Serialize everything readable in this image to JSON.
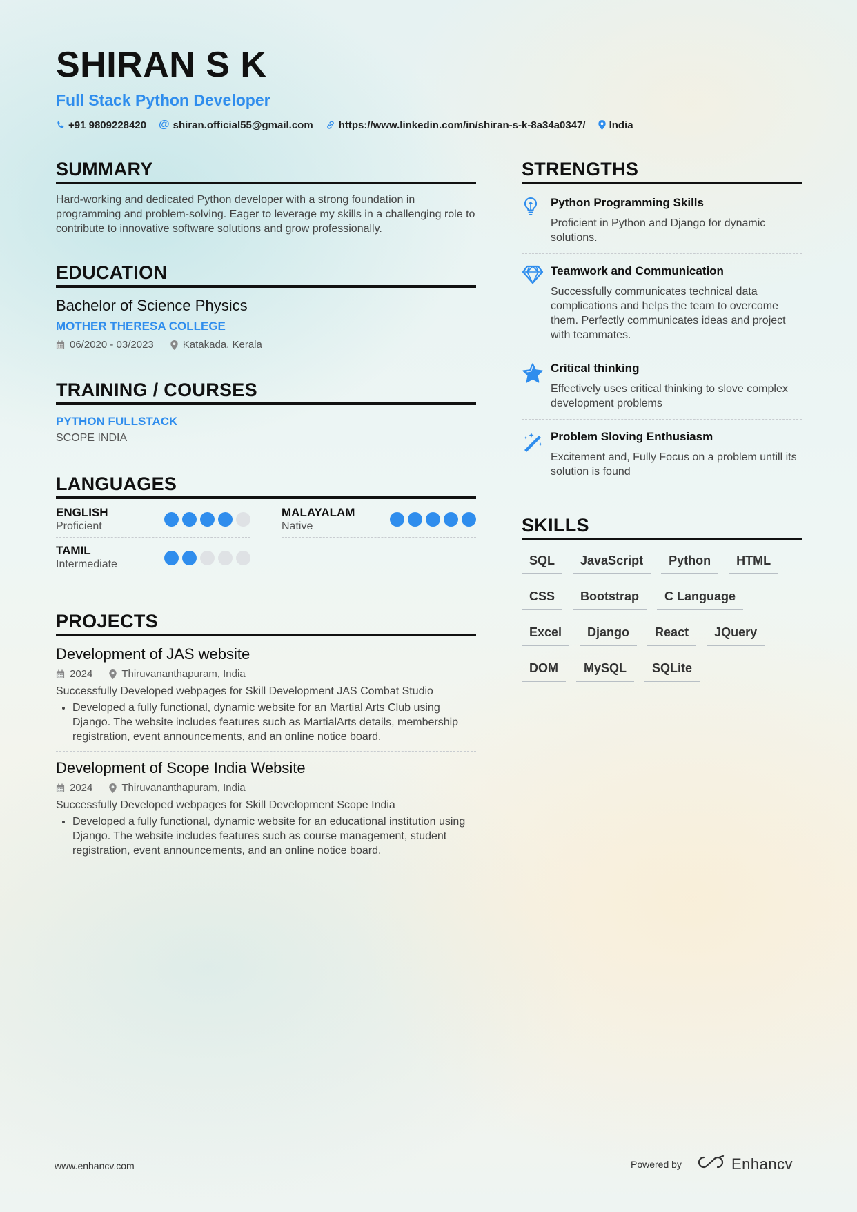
{
  "header": {
    "name": "SHIRAN S K",
    "title": "Full Stack Python Developer",
    "phone": "+91 9809228420",
    "email": "shiran.official55@gmail.com",
    "linkedin": "https://www.linkedin.com/in/shiran-s-k-8a34a0347/",
    "location": "India"
  },
  "summary": {
    "heading": "SUMMARY",
    "text": "Hard-working and dedicated Python developer with a strong foundation in programming and problem-solving. Eager to leverage my skills in a challenging role to contribute to innovative software solutions and grow professionally."
  },
  "education": {
    "heading": "EDUCATION",
    "degree": "Bachelor of Science Physics",
    "school": "MOTHER THERESA COLLEGE",
    "dates": "06/2020 - 03/2023",
    "location": "Katakada, Kerala"
  },
  "courses": {
    "heading": "TRAINING / COURSES",
    "name": "PYTHON FULLSTACK",
    "org": "SCOPE INDIA"
  },
  "languages": {
    "heading": "LANGUAGES",
    "items": [
      {
        "name": "ENGLISH",
        "level": "Proficient",
        "rating": 4
      },
      {
        "name": "MALAYALAM",
        "level": "Native",
        "rating": 5
      },
      {
        "name": "TAMIL",
        "level": "Intermediate",
        "rating": 2
      }
    ]
  },
  "projects": {
    "heading": "PROJECTS",
    "items": [
      {
        "title": "Development of JAS website",
        "year": "2024",
        "location": "Thiruvananthapuram, India",
        "desc": "Successfully Developed webpages for Skill Development  JAS Combat Studio",
        "bullet": "Developed a fully functional, dynamic website for an Martial Arts Club using Django. The website includes features such as MartialArts details, membership registration, event announcements, and an online notice board."
      },
      {
        "title": "Development of Scope India Website",
        "year": "2024",
        "location": "Thiruvananthapuram, India",
        "desc": "Successfully Developed webpages for Skill Development  Scope India",
        "bullet": "Developed a fully functional, dynamic website for an educational institution using Django. The website includes features such as course management, student registration, event announcements, and an online notice board."
      }
    ]
  },
  "strengths": {
    "heading": "STRENGTHS",
    "items": [
      {
        "icon": "lightbulb-icon",
        "title": "Python Programming Skills",
        "desc": "Proficient in Python and Django for dynamic solutions."
      },
      {
        "icon": "diamond-icon",
        "title": "Teamwork and Communication",
        "desc": "Successfully communicates technical data complications and helps the team to overcome them. Perfectly communicates ideas and project with teammates."
      },
      {
        "icon": "star-icon",
        "title": "Critical thinking",
        "desc": "Effectively uses critical thinking to slove complex development problems"
      },
      {
        "icon": "magic-wand-icon",
        "title": "Problem Sloving Enthusiasm",
        "desc": "Excitement and, Fully Focus on a problem untill its solution is found"
      }
    ]
  },
  "skills": {
    "heading": "SKILLS",
    "items": [
      "SQL",
      "JavaScript",
      "Python",
      "HTML",
      "CSS",
      "Bootstrap",
      "C Language",
      "Excel",
      "Django",
      "React",
      "JQuery",
      "DOM",
      "MySQL",
      "SQLite"
    ]
  },
  "footer": {
    "website": "www.enhancv.com",
    "powered": "Powered by",
    "brand": "Enhancv"
  },
  "colors": {
    "accent": "#2f8ded",
    "text": "#222222",
    "dot_inactive": "#dfe2e5"
  }
}
